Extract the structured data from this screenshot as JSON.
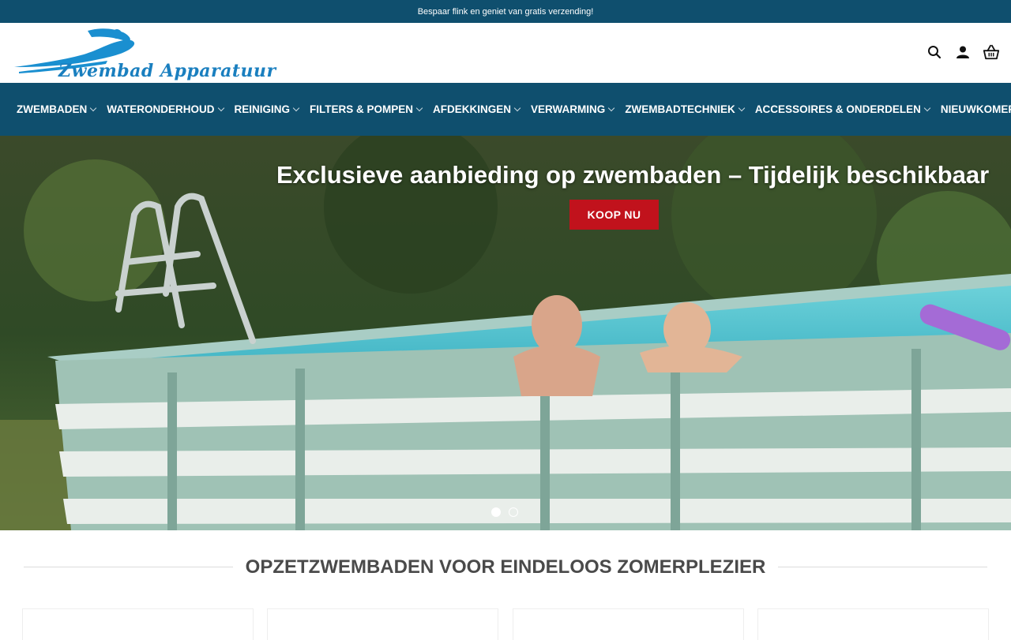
{
  "topbar": {
    "text": "Bespaar flink en geniet van gratis verzending!"
  },
  "header": {
    "logo_text": "Zwembad Apparatuur",
    "icons": [
      "search-icon",
      "account-icon",
      "cart-basket-icon"
    ]
  },
  "nav": {
    "items": [
      {
        "label": "ZWEMBADEN",
        "has_dropdown": true
      },
      {
        "label": "WATERONDERHOUD",
        "has_dropdown": true
      },
      {
        "label": "REINIGING",
        "has_dropdown": true
      },
      {
        "label": "FILTERS & POMPEN",
        "has_dropdown": true
      },
      {
        "label": "AFDEKKINGEN",
        "has_dropdown": true
      },
      {
        "label": "VERWARMING",
        "has_dropdown": true
      },
      {
        "label": "ZWEMBADTECHNIEK",
        "has_dropdown": true
      },
      {
        "label": "ACCESSOIRES & ONDERDELEN",
        "has_dropdown": true
      },
      {
        "label": "NIEUWKOMERS",
        "has_dropdown": false
      }
    ]
  },
  "hero": {
    "title": "Exclusieve aanbieding op zwembaden – Tijdelijk beschikbaar",
    "button_label": "KOOP NU",
    "slides_total": 2,
    "active_slide": 1
  },
  "section": {
    "title": "OPZETZWEMBADEN VOOR EINDELOOS ZOMERPLEZIER"
  },
  "colors": {
    "brand_dark": "#0f4f6e",
    "accent_red": "#c1121c",
    "logo_blue": "#1a7fbf"
  }
}
